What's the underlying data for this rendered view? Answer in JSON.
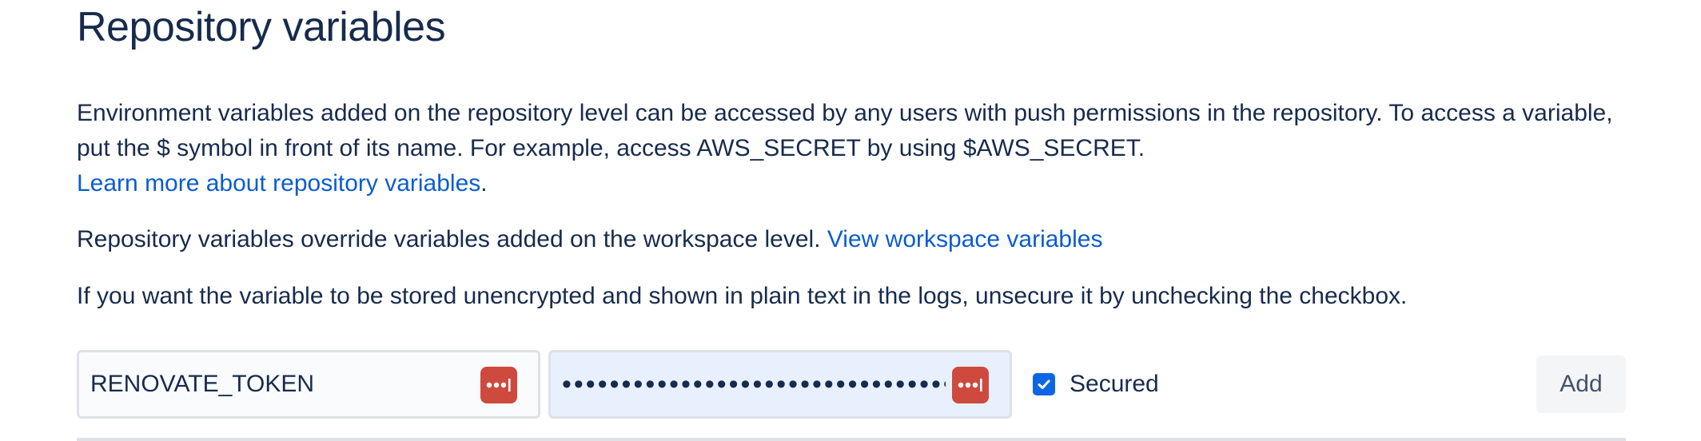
{
  "page": {
    "title": "Repository variables"
  },
  "description": {
    "line1": "Environment variables added on the repository level can be accessed by any users with push permissions in the repository. To access a variable, put the $ symbol in front of its name. For example, access AWS_SECRET by using $AWS_SECRET.",
    "learn_more_link": "Learn more about repository variables",
    "learn_more_suffix": ".",
    "override_text": "Repository variables override variables added on the workspace level. ",
    "workspace_link": "View workspace variables",
    "unsecure_text": "If you want the variable to be stored unencrypted and shown in plain text in the logs, unsecure it by unchecking the checkbox."
  },
  "form": {
    "name_value": "RENOVATE_TOKEN",
    "value_masked": "••••••••••••••••••••••••••••••••••••••••",
    "secured_label": "Secured",
    "secured_checked": true,
    "add_label": "Add"
  },
  "icons": {
    "password_manager": "password-manager-icon",
    "checkbox": "checkmark-icon"
  },
  "colors": {
    "link": "#0c5ccf",
    "checkbox": "#0c66e4",
    "password_manager_badge": "#cf4a3e",
    "value_field_bg": "#e9f0fd"
  }
}
